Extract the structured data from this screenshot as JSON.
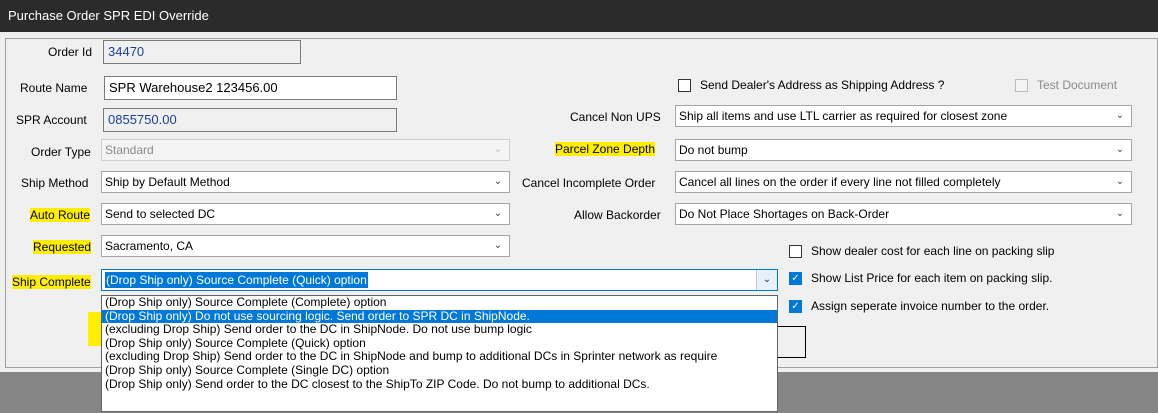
{
  "window": {
    "title": "Purchase Order SPR EDI Override"
  },
  "colors": {
    "highlight": "#ffee00",
    "selection": "#0078d7",
    "titlebar": "#2b2b2b"
  },
  "fields": {
    "order_id": {
      "label": "Order Id",
      "value": "34470"
    },
    "route_name": {
      "label": "Route Name",
      "value": "SPR Warehouse2 123456.00"
    },
    "spr_account": {
      "label": "SPR Account",
      "value": "0855750.00"
    },
    "order_type": {
      "label": "Order Type",
      "value": "Standard"
    },
    "ship_method": {
      "label": "Ship Method",
      "value": "Ship by Default Method"
    },
    "auto_route": {
      "label": "Auto Route",
      "value": "Send to selected DC"
    },
    "requested": {
      "label": "Requested",
      "value": "Sacramento, CA"
    },
    "ship_complete": {
      "label": "Ship Complete",
      "value": "(Drop Ship only) Source Complete (Quick) option"
    },
    "cancel_non_ups": {
      "label": "Cancel Non UPS",
      "value": "Ship all items and use LTL carrier as required for closest zone"
    },
    "parcel_zone_depth": {
      "label": "Parcel Zone Depth",
      "value": "Do not bump"
    },
    "cancel_incomplete_order": {
      "label": "Cancel Incomplete Order",
      "value": "Cancel all lines on the order if every line not filled completely"
    },
    "allow_backorder": {
      "label": "Allow Backorder",
      "value": "Do Not Place Shortages on Back-Order"
    }
  },
  "checkboxes": {
    "send_dealer_address": {
      "label": "Send Dealer's Address as Shipping Address ?",
      "checked": false
    },
    "test_document": {
      "label": "Test Document",
      "checked": false,
      "disabled": true
    },
    "show_dealer_cost": {
      "label": "Show dealer cost for each line on packing slip",
      "checked": false
    },
    "show_list_price": {
      "label": "Show List Price for each item on packing slip.",
      "checked": true
    },
    "assign_invoice": {
      "label": "Assign seperate invoice number to the order.",
      "checked": true
    }
  },
  "ship_complete_options": [
    "(Drop Ship only) Source Complete (Complete) option",
    "(Drop Ship only) Do not use sourcing logic. Send order to SPR DC in ShipNode.",
    "(excluding Drop Ship) Send order to the DC in ShipNode. Do not use bump logic",
    "(Drop Ship only) Source Complete (Quick) option",
    "(excluding Drop Ship) Send order to the DC in ShipNode and bump to additional DCs in Sprinter network as require",
    "(Drop Ship only) Source Complete (Single DC) option",
    "(Drop Ship only) Send order to the DC closest to the ShipTo ZIP Code. Do not bump to additional DCs."
  ],
  "ship_complete_highlighted_index": 1
}
